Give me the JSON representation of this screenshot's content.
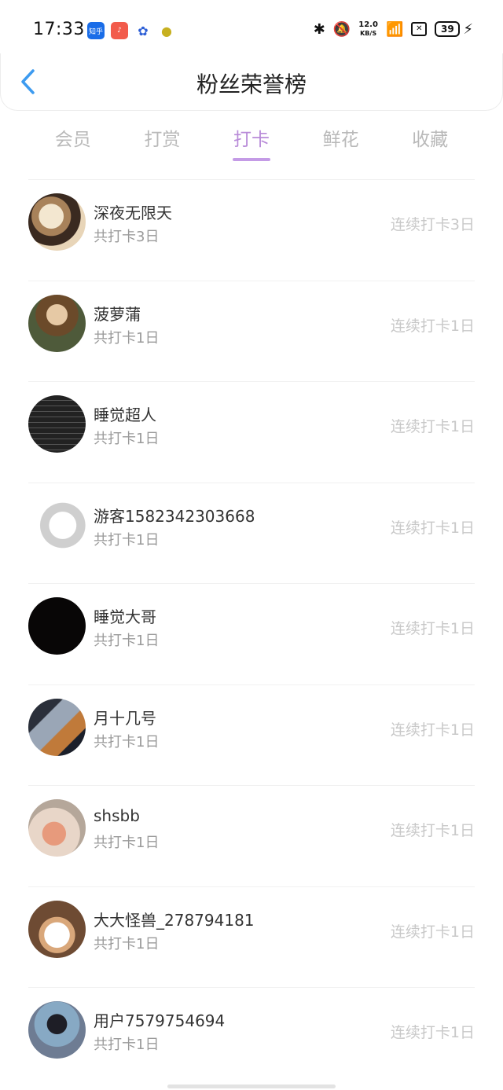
{
  "status_bar": {
    "time": "17:33",
    "app_icons": [
      "知乎",
      "music-icon",
      "baidu-paw-icon",
      "bird-icon"
    ],
    "zhihu_label": "知乎",
    "net_speed_value": "12.0",
    "net_speed_unit": "KB/S",
    "battery": "39"
  },
  "header": {
    "title": "粉丝荣誉榜",
    "back_icon": "chevron-left-icon"
  },
  "tabs": [
    {
      "label": "会员",
      "active": false
    },
    {
      "label": "打赏",
      "active": false
    },
    {
      "label": "打卡",
      "active": true
    },
    {
      "label": "鲜花",
      "active": false
    },
    {
      "label": "收藏",
      "active": false
    }
  ],
  "colors": {
    "accent": "#b88ad8",
    "indicator": "#c49be6",
    "back_arrow": "#3d9bf0"
  },
  "fans": [
    {
      "name": "深夜无限天",
      "total": "共打卡3日",
      "streak": "连续打卡3日"
    },
    {
      "name": "菠萝蒲",
      "total": "共打卡1日",
      "streak": "连续打卡1日"
    },
    {
      "name": "睡觉超人",
      "total": "共打卡1日",
      "streak": "连续打卡1日"
    },
    {
      "name": "游客1582342303668",
      "total": "共打卡1日",
      "streak": "连续打卡1日"
    },
    {
      "name": "睡觉大哥",
      "total": "共打卡1日",
      "streak": "连续打卡1日"
    },
    {
      "name": "月十几号",
      "total": "共打卡1日",
      "streak": "连续打卡1日"
    },
    {
      "name": "shsbb",
      "total": "共打卡1日",
      "streak": "连续打卡1日"
    },
    {
      "name": "大大怪兽_278794181",
      "total": "共打卡1日",
      "streak": "连续打卡1日"
    },
    {
      "name": "用户7579754694",
      "total": "共打卡1日",
      "streak": "连续打卡1日"
    }
  ]
}
